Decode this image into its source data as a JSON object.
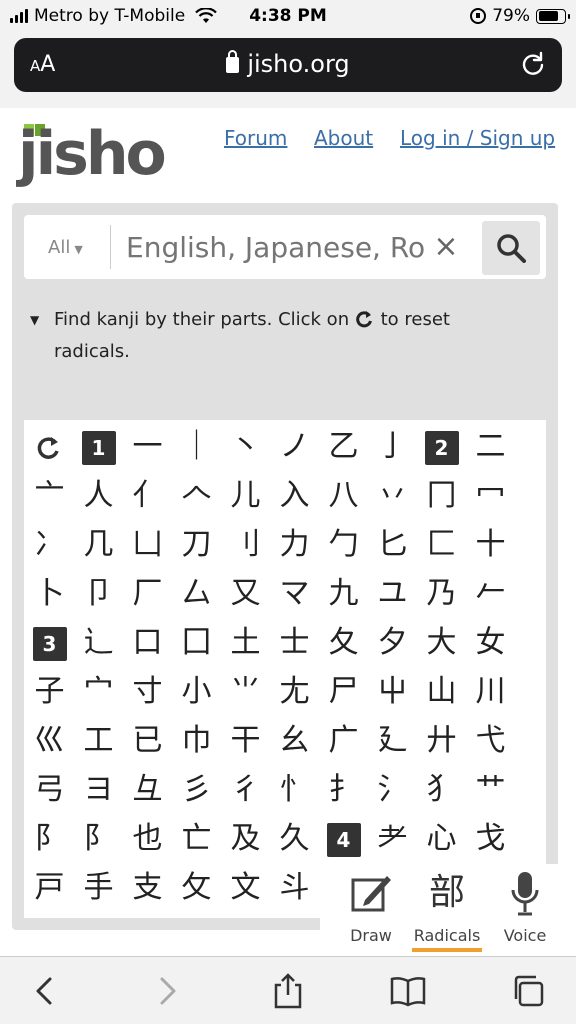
{
  "status_bar": {
    "carrier": "Metro by T-Mobile",
    "time": "4:38 PM",
    "battery": "79%"
  },
  "browser": {
    "aa_small": "A",
    "aa_large": "A",
    "url": "jisho.org"
  },
  "header": {
    "logo": "jisho",
    "nav": [
      "Forum",
      "About",
      "Log in / Sign up"
    ]
  },
  "search": {
    "filter": "All",
    "placeholder": "English, Japanese, Romaji, words or text",
    "clear": "×"
  },
  "hint": {
    "before": "Find kanji by their parts. Click on",
    "after": "to reset radicals."
  },
  "radicals": [
    "↻",
    "1",
    "一",
    "｜",
    "丶",
    "ノ",
    "乙",
    "亅",
    "2",
    "二",
    "亠",
    "人",
    "亻",
    "𠆢",
    "儿",
    "入",
    "八",
    "丷",
    "冂",
    "冖",
    "冫",
    "几",
    "凵",
    "刀",
    "刂",
    "力",
    "勹",
    "匕",
    "匚",
    "十",
    "卜",
    "卩",
    "厂",
    "厶",
    "又",
    "マ",
    "九",
    "ユ",
    "乃",
    "𠂉",
    "3",
    "⻌",
    "口",
    "囗",
    "土",
    "士",
    "夂",
    "夕",
    "大",
    "女",
    "子",
    "宀",
    "寸",
    "小",
    "⺌",
    "尢",
    "尸",
    "屮",
    "山",
    "川",
    "巛",
    "工",
    "已",
    "巾",
    "干",
    "幺",
    "广",
    "廴",
    "廾",
    "弋",
    "弓",
    "ヨ",
    "彑",
    "彡",
    "彳",
    "忄",
    "扌",
    "氵",
    "犭",
    "艹",
    "阝",
    "阝",
    "也",
    "亡",
    "及",
    "久",
    "4",
    "⺹",
    "心",
    "戈",
    "戸",
    "手",
    "支",
    "攵",
    "文",
    "斗",
    "",
    "",
    "",
    ""
  ],
  "dock": {
    "draw": "Draw",
    "radicals": "Radicals",
    "radicals_glyph": "部",
    "voice": "Voice"
  }
}
